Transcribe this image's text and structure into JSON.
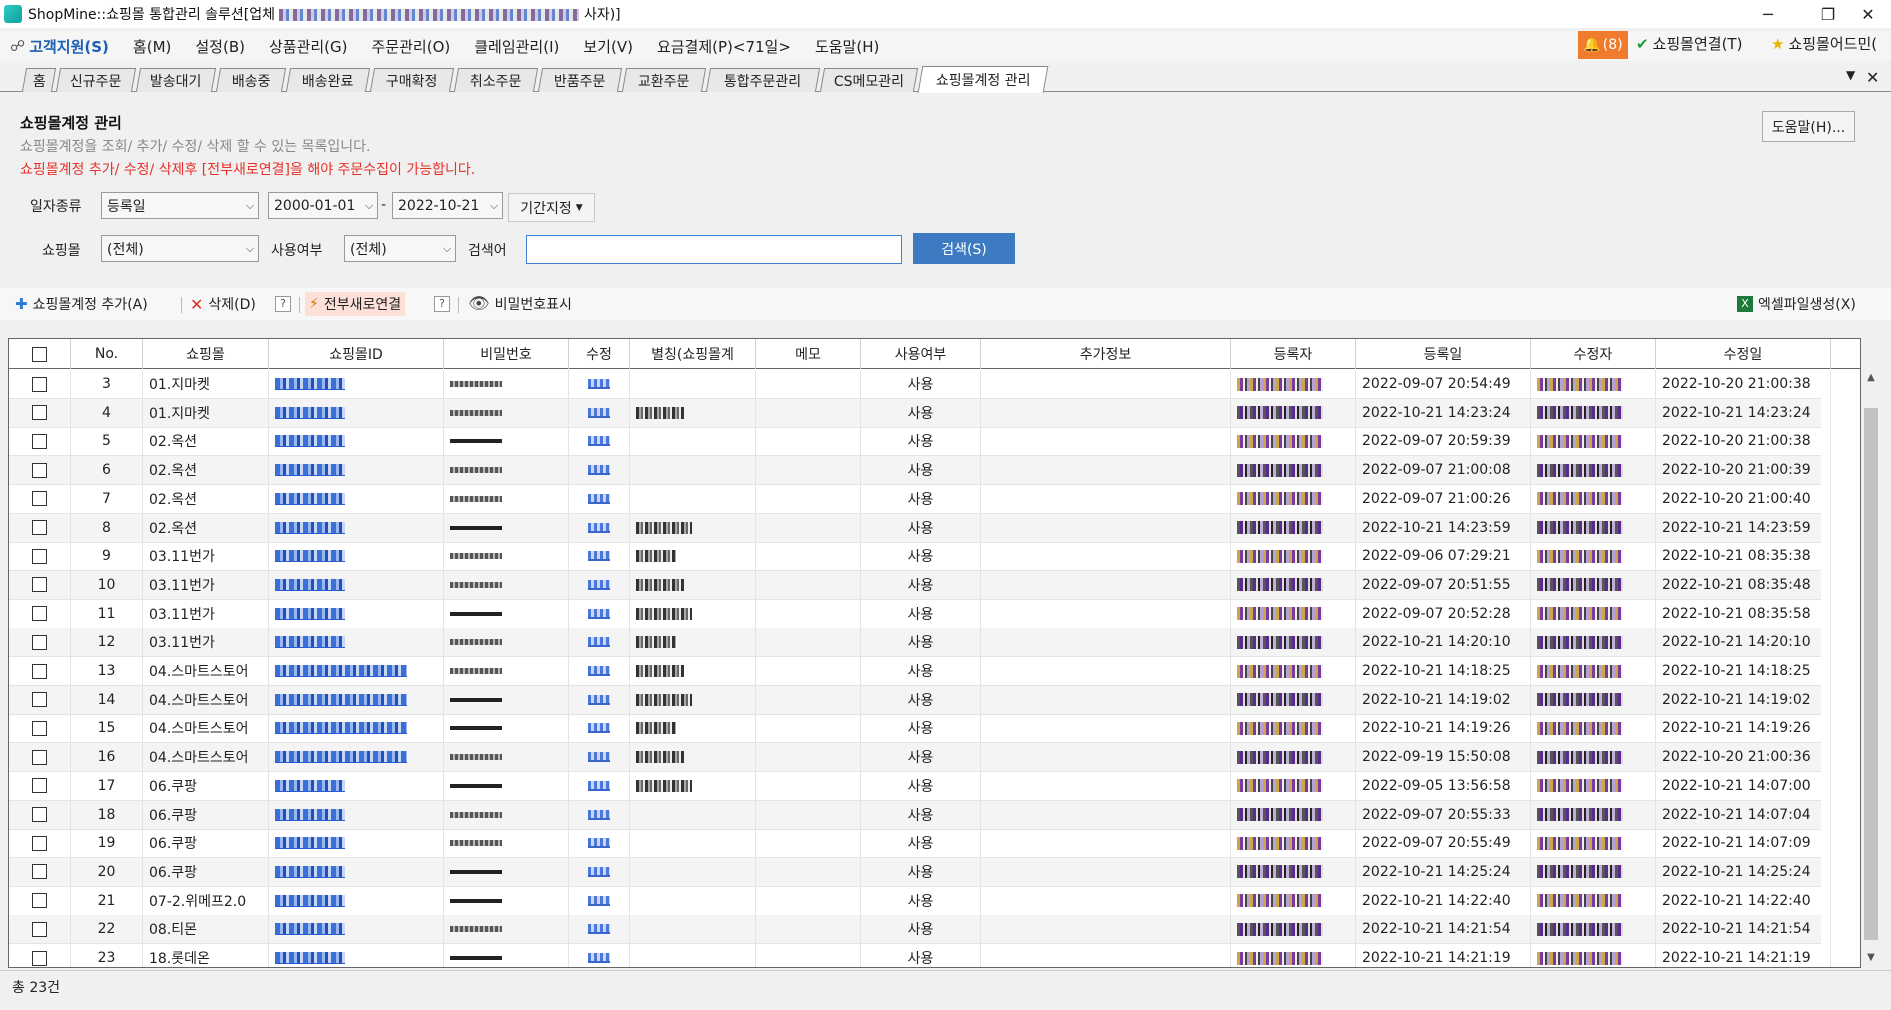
{
  "window": {
    "title_prefix": "ShopMine::쇼핑몰 통합관리 솔루션[업체",
    "title_suffix": "사자)]",
    "minimize": "─",
    "maximize": "❐",
    "close": "✕"
  },
  "menubar": {
    "support": "고객지원(S)",
    "items": [
      "홈(M)",
      "설정(B)",
      "상품관리(G)",
      "주문관리(O)",
      "클레임관리(I)",
      "보기(V)",
      "요금결제(P)<71일>",
      "도움말(H)"
    ],
    "notifications": "(8)",
    "connect": "쇼핑몰연결(T)",
    "admin": "쇼핑몰어드민("
  },
  "tabs": [
    "홈",
    "신규주문",
    "발송대기",
    "배송중",
    "배송완료",
    "구매확정",
    "취소주문",
    "반품주문",
    "교환주문",
    "통합주문관리",
    "CS메모관리",
    "쇼핑몰계정 관리"
  ],
  "tab_controls": {
    "dropdown": "▼",
    "close": "✕"
  },
  "header": {
    "title": "쇼핑몰계정 관리",
    "description": "쇼핑몰계정을 조회/ 추가/ 수정/ 삭제 할 수 있는 목록입니다.",
    "warning": "쇼핑몰계정 추가/ 수정/ 삭제후 [전부새로연결]을 해야 주문수집이 가능합니다.",
    "help_button": "도움말(H)..."
  },
  "filters": {
    "date_type_label": "일자종류",
    "date_type_value": "등록일",
    "date_from": "2000-01-01",
    "date_to": "2022-10-21",
    "date_sep": "-",
    "period_button": "기간지정",
    "mall_label": "쇼핑몰",
    "mall_value": "(전체)",
    "usage_label": "사용여부",
    "usage_value": "(전체)",
    "search_label": "검색어",
    "search_value": "",
    "search_button": "검색(S)"
  },
  "toolbar": {
    "add": "쇼핑몰계정 추가(A)",
    "delete": "삭제(D)",
    "reconnect": "전부새로연결",
    "show_password": "비밀번호표시",
    "excel": "엑셀파일생성(X)",
    "help_mark": "?"
  },
  "grid": {
    "columns": [
      "No.",
      "쇼핑몰",
      "쇼핑몰ID",
      "비밀번호",
      "수정",
      "별칭(쇼핑몰계",
      "메모",
      "사용여부",
      "추가정보",
      "등록자",
      "등록일",
      "수정자",
      "수정일"
    ],
    "rows": [
      {
        "no": "3",
        "mall": "01.지마켓",
        "use": "사용",
        "reg_date": "2022-09-07 20:54:49",
        "mod_date": "2022-10-20 21:00:38",
        "nick": false
      },
      {
        "no": "4",
        "mall": "01.지마켓",
        "use": "사용",
        "reg_date": "2022-10-21 14:23:24",
        "mod_date": "2022-10-21 14:23:24",
        "nick": true
      },
      {
        "no": "5",
        "mall": "02.옥션",
        "use": "사용",
        "reg_date": "2022-09-07 20:59:39",
        "mod_date": "2022-10-20 21:00:38",
        "nick": false
      },
      {
        "no": "6",
        "mall": "02.옥션",
        "use": "사용",
        "reg_date": "2022-09-07 21:00:08",
        "mod_date": "2022-10-20 21:00:39",
        "nick": false
      },
      {
        "no": "7",
        "mall": "02.옥션",
        "use": "사용",
        "reg_date": "2022-09-07 21:00:26",
        "mod_date": "2022-10-20 21:00:40",
        "nick": false
      },
      {
        "no": "8",
        "mall": "02.옥션",
        "use": "사용",
        "reg_date": "2022-10-21 14:23:59",
        "mod_date": "2022-10-21 14:23:59",
        "nick": true
      },
      {
        "no": "9",
        "mall": "03.11번가",
        "use": "사용",
        "reg_date": "2022-09-06 07:29:21",
        "mod_date": "2022-10-21 08:35:38",
        "nick": true
      },
      {
        "no": "10",
        "mall": "03.11번가",
        "use": "사용",
        "reg_date": "2022-09-07 20:51:55",
        "mod_date": "2022-10-21 08:35:48",
        "nick": true
      },
      {
        "no": "11",
        "mall": "03.11번가",
        "use": "사용",
        "reg_date": "2022-09-07 20:52:28",
        "mod_date": "2022-10-21 08:35:58",
        "nick": true
      },
      {
        "no": "12",
        "mall": "03.11번가",
        "use": "사용",
        "reg_date": "2022-10-21 14:20:10",
        "mod_date": "2022-10-21 14:20:10",
        "nick": true
      },
      {
        "no": "13",
        "mall": "04.스마트스토어",
        "use": "사용",
        "reg_date": "2022-10-21 14:18:25",
        "mod_date": "2022-10-21 14:18:25",
        "nick": true
      },
      {
        "no": "14",
        "mall": "04.스마트스토어",
        "use": "사용",
        "reg_date": "2022-10-21 14:19:02",
        "mod_date": "2022-10-21 14:19:02",
        "nick": true
      },
      {
        "no": "15",
        "mall": "04.스마트스토어",
        "use": "사용",
        "reg_date": "2022-10-21 14:19:26",
        "mod_date": "2022-10-21 14:19:26",
        "nick": true
      },
      {
        "no": "16",
        "mall": "04.스마트스토어",
        "use": "사용",
        "reg_date": "2022-09-19 15:50:08",
        "mod_date": "2022-10-20 21:00:36",
        "nick": true
      },
      {
        "no": "17",
        "mall": "06.쿠팡",
        "use": "사용",
        "reg_date": "2022-09-05 13:56:58",
        "mod_date": "2022-10-21 14:07:00",
        "nick": true
      },
      {
        "no": "18",
        "mall": "06.쿠팡",
        "use": "사용",
        "reg_date": "2022-09-07 20:55:33",
        "mod_date": "2022-10-21 14:07:04",
        "nick": false
      },
      {
        "no": "19",
        "mall": "06.쿠팡",
        "use": "사용",
        "reg_date": "2022-09-07 20:55:49",
        "mod_date": "2022-10-21 14:07:09",
        "nick": false
      },
      {
        "no": "20",
        "mall": "06.쿠팡",
        "use": "사용",
        "reg_date": "2022-10-21 14:25:24",
        "mod_date": "2022-10-21 14:25:24",
        "nick": false
      },
      {
        "no": "21",
        "mall": "07-2.위메프2.0",
        "use": "사용",
        "reg_date": "2022-10-21 14:22:40",
        "mod_date": "2022-10-21 14:22:40",
        "nick": false
      },
      {
        "no": "22",
        "mall": "08.티몬",
        "use": "사용",
        "reg_date": "2022-10-21 14:21:54",
        "mod_date": "2022-10-21 14:21:54",
        "nick": false
      },
      {
        "no": "23",
        "mall": "18.롯데온",
        "use": "사용",
        "reg_date": "2022-10-21 14:21:19",
        "mod_date": "2022-10-21 14:21:19",
        "nick": false
      }
    ]
  },
  "status": {
    "total": "총 23건"
  },
  "colors": {
    "accent": "#3c7bc2",
    "warning": "#e8312a",
    "badge": "#f07b2c",
    "support": "#1a5fb4"
  }
}
